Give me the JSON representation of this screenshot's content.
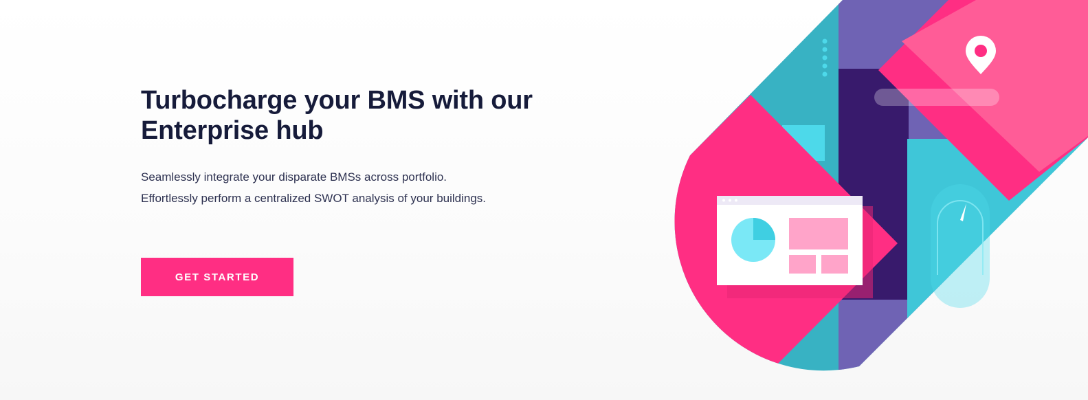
{
  "hero": {
    "headline": "Turbocharge your BMS with our Enterprise hub",
    "subtext": "Seamlessly integrate your disparate BMSs across portfolio. Effortlessly perform a centralized SWOT analysis of your buildings.",
    "cta_label": "GET STARTED"
  },
  "colors": {
    "accent_pink": "#ff2e83",
    "heading_navy": "#161b3a",
    "teal": "#38b2c3",
    "purple": "#6f63b4",
    "deep_purple": "#381a6c",
    "cyan": "#4dd9ea",
    "light_pink": "#ff5c97"
  },
  "illustration": {
    "icons": [
      "location-pin-icon",
      "pie-chart-icon",
      "gauge-icon"
    ]
  }
}
